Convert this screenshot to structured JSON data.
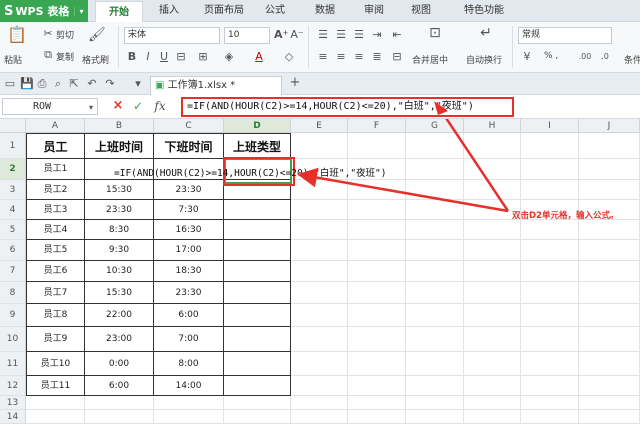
{
  "app": {
    "name": "WPS 表格"
  },
  "menu_tabs": [
    "开始",
    "插入",
    "页面布局",
    "公式",
    "数据",
    "审阅",
    "视图",
    "特色功能"
  ],
  "ribbon": {
    "paste": "粘贴",
    "cut": "剪切",
    "copy": "复制",
    "format_painter": "格式刷",
    "font_name": "宋体",
    "font_size": "10",
    "merge_center": "合并居中",
    "wrap_text": "自动换行",
    "number_format": "常规",
    "percent_etc": "% ,",
    "cond": "条件"
  },
  "document": {
    "tab_name": "工作簿1.xlsx *",
    "add": "+"
  },
  "formula_bar": {
    "name_box": "ROW",
    "cancel": "×",
    "confirm": "✓",
    "fx": "fx",
    "formula": "=IF(AND(HOUR(C2)>=14,HOUR(C2)<=20),\"白班\",\"夜班\")"
  },
  "columns": [
    "A",
    "B",
    "C",
    "D",
    "E",
    "F",
    "G",
    "H",
    "I",
    "J"
  ],
  "rows": [
    "1",
    "2",
    "3",
    "4",
    "5",
    "6",
    "7",
    "8",
    "9",
    "10",
    "11",
    "12",
    "13",
    "14"
  ],
  "table": {
    "headers": [
      "员工",
      "上班时间",
      "下班时间",
      "上班类型"
    ],
    "in_cell_formula": "=IF(AND(HOUR(C2)>=14,HOUR(C2)<=20),\"白班\",\"夜班\")",
    "rows": [
      [
        "员工1",
        "",
        "",
        ""
      ],
      [
        "员工2",
        "15:30",
        "23:30",
        ""
      ],
      [
        "员工3",
        "23:30",
        "7:30",
        ""
      ],
      [
        "员工4",
        "8:30",
        "16:30",
        ""
      ],
      [
        "员工5",
        "9:30",
        "17:00",
        ""
      ],
      [
        "员工6",
        "10:30",
        "18:30",
        ""
      ],
      [
        "员工7",
        "15:30",
        "23:30",
        ""
      ],
      [
        "员工8",
        "22:00",
        "6:00",
        ""
      ],
      [
        "员工9",
        "23:00",
        "7:00",
        ""
      ],
      [
        "员工10",
        "0:00",
        "8:00",
        ""
      ],
      [
        "员工11",
        "6:00",
        "14:00",
        ""
      ]
    ]
  },
  "annotation": "双击D2单元格，输入公式。",
  "colors": {
    "accent": "#3aa652",
    "highlight": "#e8302a"
  }
}
